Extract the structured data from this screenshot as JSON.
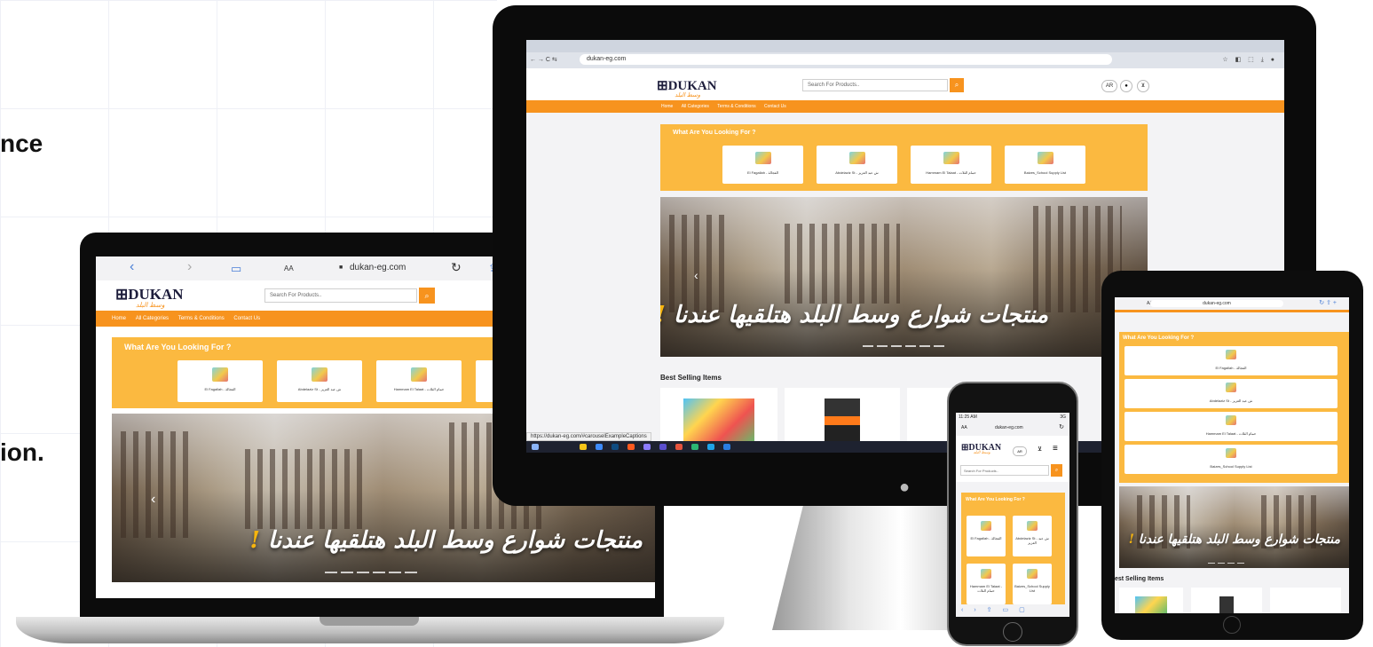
{
  "page": {
    "side_text": [
      "nce",
      "ion."
    ]
  },
  "brand": {
    "logo": "DUKAN",
    "logo_sub": "وسط البلد",
    "accent": "#f7931e",
    "panel": "#fbb940"
  },
  "site": {
    "search_placeholder": "Search For Products..",
    "lang": "AR",
    "nav": [
      "Home",
      "All Categories",
      "Terms & Conditions",
      "Contact Us"
    ],
    "panel_title": "What Are You Looking For ?",
    "categories": [
      "El Fagallah - الفجالة",
      "Abdelaziz St - ش عبد العزيز",
      "Hammam El Talaat - حمام التلات",
      "Baizes_School Supply List"
    ],
    "hero_text": "منتجات شوارع وسط البلد هتلقيها عندنا",
    "hero_exclaim": "!",
    "best_selling": "Best Selling Items",
    "best_selling_partial": "est Selling Items"
  },
  "desktop": {
    "url": "dukan-eg.com",
    "status_url": "https://dukan-eg.com/#carouselExampleCaptions",
    "toolbar_icons": "☆ ◧ ⬚ ⤓ ●"
  },
  "laptop": {
    "url": "dukan-eg.com",
    "text_size": "AA",
    "back": "‹",
    "forward": "›",
    "reload": "↻"
  },
  "ipad": {
    "url": "dukan-eg.com",
    "text_size": "AA"
  },
  "phone": {
    "time": "11:25 AM",
    "signal": "3G",
    "url": "dukan-eg.com",
    "text_size": "AA",
    "panel_title": "What Are You Looking For ?"
  }
}
